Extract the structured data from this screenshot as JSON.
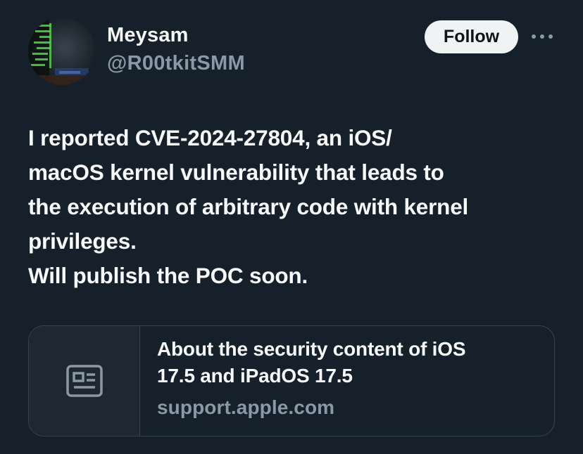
{
  "author": {
    "name": "Meysam",
    "handle": "@R00tkitSMM"
  },
  "header": {
    "follow_label": "Follow"
  },
  "icons": {
    "avatar": "avatar-image",
    "more": "more-horizontal-icon",
    "card": "article-icon"
  },
  "tweet": {
    "lines": [
      "I reported CVE-2024-27804, an iOS/",
      "macOS kernel vulnerability that leads to",
      "the execution of arbitrary code with kernel",
      "privileges.",
      "Will publish the POC soon."
    ]
  },
  "link_card": {
    "title_lines": [
      "About the security content of iOS",
      "17.5 and iPadOS 17.5"
    ],
    "domain": "support.apple.com"
  },
  "colors": {
    "background": "#15202b",
    "text_primary": "#f7f9f9",
    "text_secondary": "#8b98a5",
    "border": "#38444d",
    "follow_bg": "#eff3f4"
  }
}
